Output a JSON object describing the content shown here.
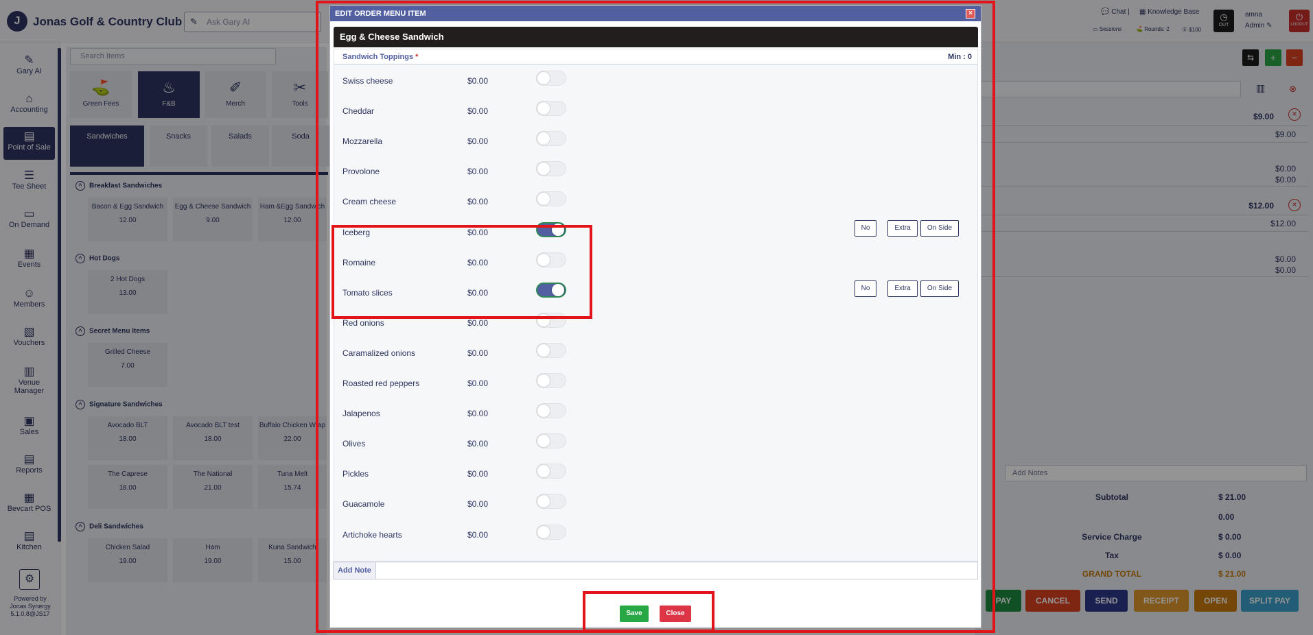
{
  "header": {
    "club_name": "Jonas Golf & Country Club",
    "ask_placeholder": "Ask Gary AI",
    "chat": "Chat",
    "knowledge_base": "Knowledge Base",
    "sessions": "Sessions",
    "rounds": "Rounds: 2",
    "money": "$100",
    "clock_label": "OUT",
    "user_name": "amna",
    "user_role": "Admin",
    "logout_label": "LOGOUT"
  },
  "sidebar": {
    "items": [
      {
        "label": "Gary AI",
        "icon": "gary-ai-icon",
        "glyph": "✎"
      },
      {
        "label": "Accounting",
        "icon": "bank-icon",
        "glyph": "⌂"
      },
      {
        "label": "Point of Sale",
        "icon": "register-icon",
        "glyph": "▤"
      },
      {
        "label": "Tee Sheet",
        "icon": "sheet-icon",
        "glyph": "☰"
      },
      {
        "label": "On Demand",
        "icon": "monitor-icon",
        "glyph": "▭"
      },
      {
        "label": "Events",
        "icon": "calendar-icon",
        "glyph": "▦"
      },
      {
        "label": "Members",
        "icon": "members-icon",
        "glyph": "☺"
      },
      {
        "label": "Vouchers",
        "icon": "voucher-icon",
        "glyph": "▧"
      },
      {
        "label": "Venue Manager",
        "icon": "building-icon",
        "glyph": "▥"
      },
      {
        "label": "Sales",
        "icon": "sales-icon",
        "glyph": "▣"
      },
      {
        "label": "Reports",
        "icon": "report-icon",
        "glyph": "▤"
      },
      {
        "label": "Bevcart POS",
        "icon": "grid-icon",
        "glyph": "▦"
      },
      {
        "label": "Kitchen",
        "icon": "kitchen-icon",
        "glyph": "▤"
      }
    ],
    "powered_by": "Powered by",
    "company": "Jonas Synergy",
    "version": "5.1.0.8@JS17"
  },
  "pos": {
    "search_placeholder": "Search Items",
    "categories": [
      {
        "label": "Green Fees",
        "glyph": "⛳"
      },
      {
        "label": "F&B",
        "glyph": "♨"
      },
      {
        "label": "Merch",
        "glyph": "✐"
      },
      {
        "label": "Tools",
        "glyph": "✂"
      }
    ],
    "subcategories": [
      "Sandwiches",
      "Snacks",
      "Salads",
      "Soda"
    ],
    "sections": [
      {
        "title": "Breakfast Sandwiches",
        "items": [
          {
            "name": "Bacon & Egg Sandwich",
            "price": "12.00"
          },
          {
            "name": "Egg & Cheese Sandwich",
            "price": "9.00"
          },
          {
            "name": "Ham &Egg Sandwich",
            "price": "12.00"
          }
        ]
      },
      {
        "title": "Hot Dogs",
        "items": [
          {
            "name": "2 Hot Dogs",
            "price": "13.00"
          }
        ]
      },
      {
        "title": "Secret Menu Items",
        "items": [
          {
            "name": "Grilled Cheese",
            "price": "7.00"
          }
        ]
      },
      {
        "title": "Signature Sandwiches",
        "items": [
          {
            "name": "Avocado BLT",
            "price": "18.00"
          },
          {
            "name": "Avocado BLT test",
            "price": "18.00"
          },
          {
            "name": "Buffalo Chicken Wrap",
            "price": "22.00"
          },
          {
            "name": "The Caprese",
            "price": "18.00"
          },
          {
            "name": "The National",
            "price": "21.00"
          },
          {
            "name": "Tuna Melt",
            "price": "15.74"
          }
        ]
      },
      {
        "title": "Deli Sandwiches",
        "items": [
          {
            "name": "Chicken Salad",
            "price": "19.00"
          },
          {
            "name": "Ham",
            "price": "19.00"
          },
          {
            "name": "Kuna Sandwich",
            "price": "15.00"
          }
        ]
      }
    ]
  },
  "order": {
    "line1_price": "$9.00",
    "line1_sub": "$9.00",
    "line1_a": "$0.00",
    "line1_b": "$0.00",
    "line2_price": "$12.00",
    "line2_sub": "$12.00",
    "line2_a": "$0.00",
    "line2_b": "$0.00",
    "add_notes_placeholder": "Add Notes",
    "totals": [
      {
        "label": "Subtotal",
        "value": "$ 21.00"
      },
      {
        "label": "",
        "value": "0.00"
      },
      {
        "label": "Service Charge",
        "value": "$ 0.00"
      },
      {
        "label": "Tax",
        "value": "$ 0.00"
      },
      {
        "label": "GRAND TOTAL",
        "value": "$ 21.00"
      }
    ],
    "actions": [
      {
        "label": "PAY",
        "color": "#1e8a3e"
      },
      {
        "label": "CANCEL",
        "color": "#d9431e"
      },
      {
        "label": "SEND",
        "color": "#2d3a8c"
      },
      {
        "label": "RECEIPT",
        "color": "#e0982e"
      },
      {
        "label": "OPEN",
        "color": "#c97a10"
      },
      {
        "label": "SPLIT PAY",
        "color": "#3aa0c8"
      }
    ]
  },
  "modal": {
    "title": "EDIT ORDER MENU ITEM",
    "item_name": "Egg & Cheese Sandwich",
    "group_label": "Sandwich Toppings",
    "required_mark": "*",
    "min_label": "Min : 0",
    "toppings": [
      {
        "name": "Swiss cheese",
        "price": "$0.00",
        "on": false
      },
      {
        "name": "Cheddar",
        "price": "$0.00",
        "on": false
      },
      {
        "name": "Mozzarella",
        "price": "$0.00",
        "on": false
      },
      {
        "name": "Provolone",
        "price": "$0.00",
        "on": false
      },
      {
        "name": "Cream cheese",
        "price": "$0.00",
        "on": false
      },
      {
        "name": "Iceberg",
        "price": "$0.00",
        "on": true
      },
      {
        "name": "Romaine",
        "price": "$0.00",
        "on": false
      },
      {
        "name": "Tomato slices",
        "price": "$0.00",
        "on": true
      },
      {
        "name": "Red onions",
        "price": "$0.00",
        "on": false
      },
      {
        "name": "Caramalized onions",
        "price": "$0.00",
        "on": false
      },
      {
        "name": "Roasted red peppers",
        "price": "$0.00",
        "on": false
      },
      {
        "name": "Jalapenos",
        "price": "$0.00",
        "on": false
      },
      {
        "name": "Olives",
        "price": "$0.00",
        "on": false
      },
      {
        "name": "Pickles",
        "price": "$0.00",
        "on": false
      },
      {
        "name": "Guacamole",
        "price": "$0.00",
        "on": false
      },
      {
        "name": "Artichoke hearts",
        "price": "$0.00",
        "on": false
      }
    ],
    "option_buttons": [
      "No",
      "Extra",
      "On Side"
    ],
    "add_note_label": "Add Note",
    "add_note_value": "",
    "save_label": "Save",
    "close_label": "Close"
  },
  "colors": {
    "primary": "#2d3561",
    "modal_header": "#525fa0",
    "save": "#28a745",
    "close": "#dc3545",
    "highlight": "#e3131a"
  }
}
